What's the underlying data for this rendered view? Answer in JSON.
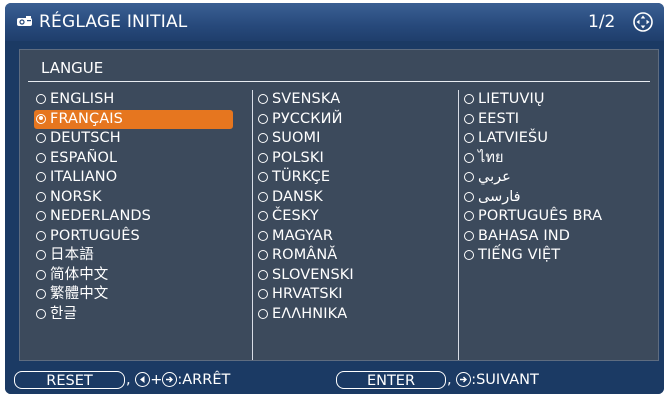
{
  "window": {
    "title": "RÉGLAGE INITIAL",
    "page": "1/2"
  },
  "panel": {
    "title": "LANGUE"
  },
  "languages": {
    "col1": [
      "ENGLISH",
      "FRANÇAIS",
      "DEUTSCH",
      "ESPAÑOL",
      "ITALIANO",
      "NORSK",
      "NEDERLANDS",
      "PORTUGUÊS",
      "日本語",
      "简体中文",
      "繁體中文",
      "한글"
    ],
    "col2": [
      "SVENSKA",
      "РУССКИЙ",
      "SUOMI",
      "POLSKI",
      "TÜRKÇE",
      "DANSK",
      "ČESKY",
      "MAGYAR",
      "ROMÂNĂ",
      "SLOVENSKI",
      "HRVATSKI",
      "ΕΛΛΗΝΙΚΑ"
    ],
    "col3": [
      "LIETUVIŲ",
      "EESTI",
      "LATVIEŠU",
      "ไทย",
      "عربي",
      "فارسی",
      "PORTUGUÊS BRA",
      "BAHASA IND",
      "TIẾNG VIỆT"
    ],
    "selected": "FRANÇAIS"
  },
  "footer": {
    "reset_label": "RESET",
    "reset_hint": ":ARRÊT",
    "enter_label": "ENTER",
    "enter_hint": ":SUIVANT"
  },
  "colors": {
    "background": "#1b3a64",
    "panel": "#3c4a5c",
    "selected": "#e6761f"
  },
  "icons": [
    "projector-icon",
    "navigation-icon",
    "left-arrow-icon",
    "enter-icon"
  ]
}
